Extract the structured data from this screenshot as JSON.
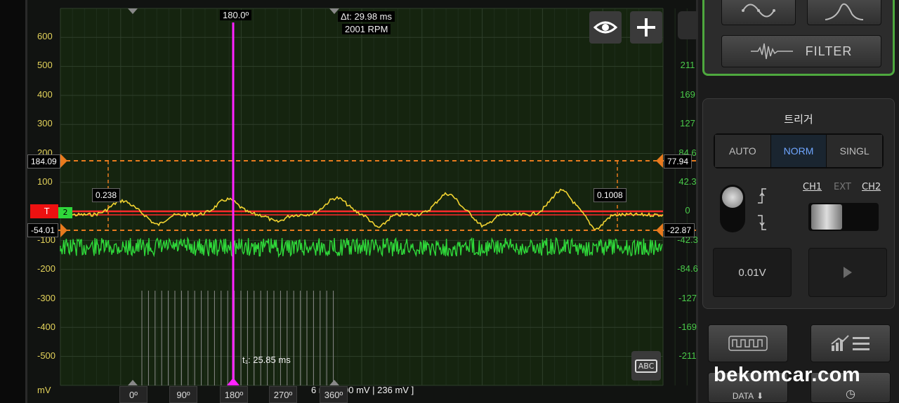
{
  "scope": {
    "y_unit": "mV",
    "left_ticks": [
      "600",
      "500",
      "400",
      "300",
      "200",
      "100",
      "-100",
      "-200",
      "-300",
      "-400",
      "-500"
    ],
    "right_ticks": [
      "211",
      "169",
      "127",
      "84.6",
      "42.3",
      "0",
      "-42.3",
      "-84.6",
      "-127",
      "-169",
      "-211"
    ],
    "left_upper_marker": "184.09",
    "left_lower_marker": "-54.01",
    "right_upper_marker": "77.94",
    "right_lower_marker": "-22.87",
    "trigger_flag": "T",
    "channel_flag": "2",
    "cursor_left_value": "0.238",
    "cursor_right_value": "0.1008",
    "cursor_angle": "180.0º",
    "delta_t": "Δt: 29.98 ms",
    "rpm": "2001 RPM",
    "t1": "t₁: 25.85 ms",
    "bottom_status": "6 ms | 100 mV | 236 mV ]",
    "degree_labels": [
      "0º",
      "90º",
      "180º",
      "270º",
      "360º"
    ],
    "colors": {
      "ch1": "#f2d431",
      "ch2": "#2fd83a",
      "cursor": "#ff22ff",
      "trigger": "#ff2a2a",
      "marker": "#e87a1e"
    }
  },
  "buttons": {
    "eye": "eye-icon",
    "plus": "plus-icon",
    "abc": "ABC"
  },
  "panel": {
    "filter_label": "FILTER",
    "trigger_title": "트리거",
    "modes": [
      "AUTO",
      "NORM",
      "SINGL"
    ],
    "channel_labels": {
      "ch1": "CH1",
      "ext": "EXT",
      "ch2": "CH2"
    },
    "level_value": "0.01V",
    "data_label": "DATA"
  },
  "watermark": "bekomcar.com"
}
